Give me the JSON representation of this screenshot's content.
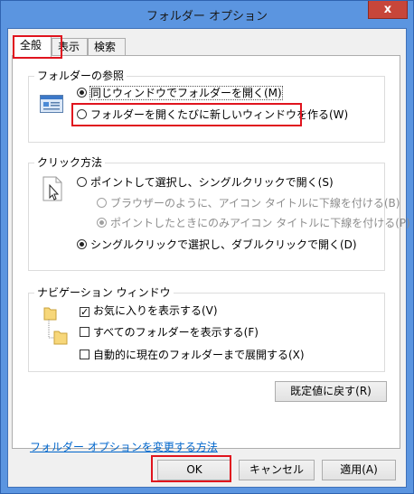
{
  "window": {
    "title": "フォルダー オプション",
    "close_glyph": "x"
  },
  "tabs": [
    {
      "label": "全般",
      "active": true
    },
    {
      "label": "表示",
      "active": false
    },
    {
      "label": "検索",
      "active": false
    }
  ],
  "browse_folders": {
    "legend": "フォルダーの参照",
    "options": [
      {
        "label": "同じウィンドウでフォルダーを開く(M)",
        "selected": true
      },
      {
        "label": "フォルダーを開くたびに新しいウィンドウを作る(W)",
        "selected": false
      }
    ]
  },
  "click_items": {
    "legend": "クリック方法",
    "single_click": {
      "label": "ポイントして選択し、シングルクリックで開く(S)",
      "selected": false
    },
    "sub_options": [
      {
        "label": "ブラウザーのように、アイコン タイトルに下線を付ける(B)",
        "selected": false,
        "disabled": true
      },
      {
        "label": "ポイントしたときにのみアイコン タイトルに下線を付ける(P)",
        "selected": true,
        "disabled": true
      }
    ],
    "double_click": {
      "label": "シングルクリックで選択し、ダブルクリックで開く(D)",
      "selected": true
    }
  },
  "navigation_pane": {
    "legend": "ナビゲーション ウィンドウ",
    "options": [
      {
        "label": "お気に入りを表示する(V)",
        "checked": true
      },
      {
        "label": "すべてのフォルダーを表示する(F)",
        "checked": false
      },
      {
        "label": "自動的に現在のフォルダーまで展開する(X)",
        "checked": false
      }
    ]
  },
  "restore_defaults_label": "既定値に戻す(R)",
  "help_link": "フォルダー オプションを変更する方法",
  "buttons": {
    "ok": "OK",
    "cancel": "キャンセル",
    "apply": "適用(A)"
  },
  "colors": {
    "highlight_box": "#e0141e",
    "link": "#0066cc",
    "title_bar": "#5b95e0",
    "close_button": "#c7463a"
  }
}
